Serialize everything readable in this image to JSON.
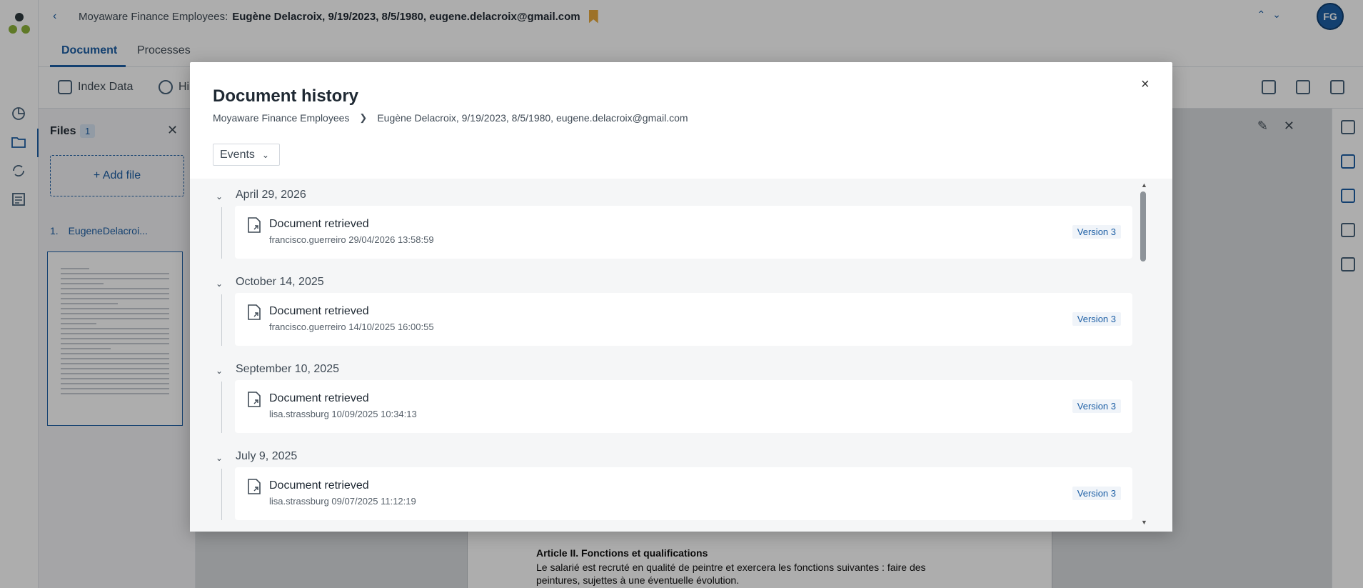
{
  "app": {
    "breadcrumb_parent": "Moyaware Finance Employees:",
    "breadcrumb_record": "Eugène Delacroix, 9/19/2023, 8/5/1980, eugene.delacroix@gmail.com",
    "avatar_initials": "FG",
    "tabs": [
      "Document",
      "Processes"
    ],
    "toolbar": [
      "Index Data",
      "Hi"
    ],
    "files": {
      "title": "Files",
      "count": "1",
      "add_label": "+ Add file",
      "items": [
        {
          "index": "1.",
          "name": "EugeneDelacroi..."
        }
      ]
    },
    "document_preview": {
      "heading": "Article II. Fonctions et qualifications",
      "text": "Le salarié est recruté en qualité de peintre et exercera les fonctions suivantes : faire des peintures, sujettes à une éventuelle évolution."
    }
  },
  "modal": {
    "title": "Document history",
    "breadcrumb": [
      "Moyaware Finance Employees",
      "Eugène Delacroix, 9/19/2023, 8/5/1980, eugene.delacroix@gmail.com"
    ],
    "filter_label": "Events",
    "close_label": "×",
    "groups": [
      {
        "date": "April 29, 2026",
        "event": "Document retrieved",
        "meta": "francisco.guerreiro 29/04/2026 13:58:59",
        "version": "Version 3"
      },
      {
        "date": "October 14, 2025",
        "event": "Document retrieved",
        "meta": "francisco.guerreiro 14/10/2025 16:00:55",
        "version": "Version 3"
      },
      {
        "date": "September 10, 2025",
        "event": "Document retrieved",
        "meta": "lisa.strassburg 10/09/2025 10:34:13",
        "version": "Version 3"
      },
      {
        "date": "July 9, 2025",
        "event": "Document retrieved",
        "meta": "lisa.strassburg 09/07/2025 11:12:19",
        "version": "Version 3"
      }
    ]
  },
  "colors": {
    "accent": "#1d5fa5",
    "bookmark": "#e8a93b",
    "overlay": "rgba(0,0,0,0.32)"
  }
}
